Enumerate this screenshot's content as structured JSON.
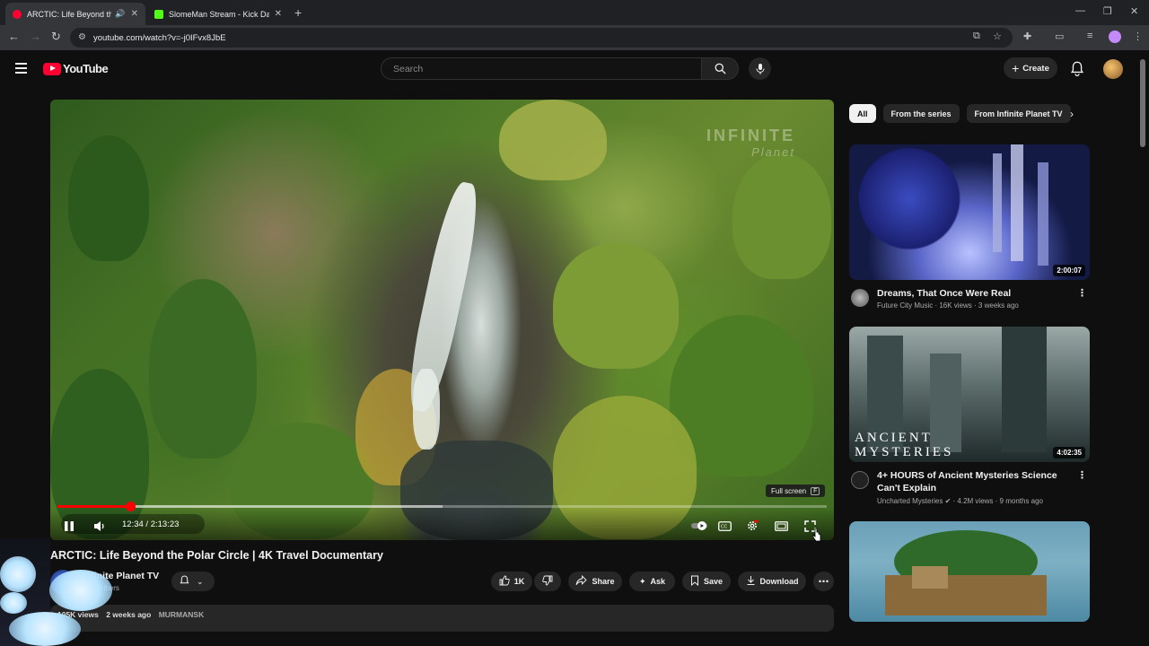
{
  "browser": {
    "tabs": [
      {
        "title": "ARCTIC: Life Beyond the Po",
        "active": true,
        "color": "#ff0033"
      },
      {
        "title": "SlomeMan Stream - Kick Dashb",
        "active": false,
        "color": "#53fc18"
      }
    ],
    "url": "youtube.com/watch?v=-j0IFvx8JbE"
  },
  "header": {
    "logo_text": "YouTube",
    "search_placeholder": "Search",
    "create_label": "Create"
  },
  "player": {
    "watermark_line1": "INFINITE",
    "watermark_line2": "Planet",
    "tooltip": "Full screen",
    "tooltip_key": "F",
    "current_time": "12:34",
    "duration": "2:13:23",
    "time_display": "12:34 / 2:13:23",
    "progress_fraction": 0.094,
    "buffered_fraction": 0.5
  },
  "video": {
    "title": "ARCTIC: Life Beyond the Polar Circle | 4K Travel Documentary",
    "channel": "Infinite Planet TV",
    "subscribers": "subscribers",
    "likes": "1K",
    "share_label": "Share",
    "ask_label": "Ask",
    "save_label": "Save",
    "download_label": "Download",
    "views": "105K views",
    "age": "2 weeks ago",
    "tag": "MURMANSK"
  },
  "sidebar": {
    "chips": [
      "All",
      "From the series",
      "From Infinite Planet TV"
    ],
    "videos": [
      {
        "title": "Dreams, That Once Were Real",
        "channel": "Future City Music",
        "views": "16K views",
        "age": "3 weeks ago",
        "duration": "2:00:07"
      },
      {
        "title": "4+ HOURS of Ancient Mysteries Science Can't Explain",
        "channel": "Uncharted Mysteries",
        "views": "4.2M views",
        "age": "9 months ago",
        "duration": "4:02:35",
        "thumb_text_1": "ANCIENT",
        "thumb_text_2": "MYSTERIES"
      },
      {
        "title": "",
        "channel": "",
        "views": "",
        "age": "",
        "duration": ""
      }
    ]
  }
}
